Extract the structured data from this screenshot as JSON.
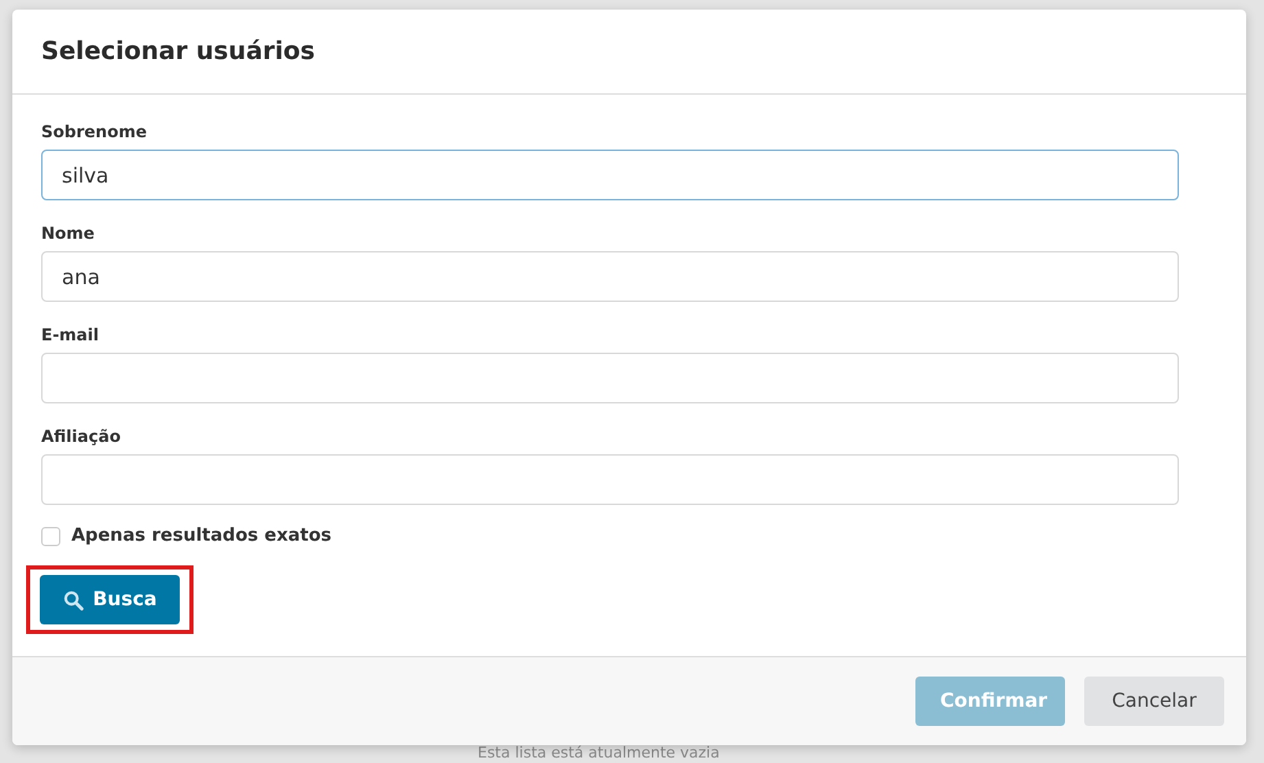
{
  "dialog": {
    "title": "Selecionar usuários",
    "fields": [
      {
        "label": "Sobrenome",
        "value": "silva",
        "focused": true
      },
      {
        "label": "Nome",
        "value": "ana",
        "focused": false
      },
      {
        "label": "E-mail",
        "focused": false
      },
      {
        "label": "Afiliação",
        "focused": false
      }
    ],
    "exact_match": {
      "label": "Apenas resultados exatos",
      "checked": false
    },
    "search_button": {
      "label": "Busca",
      "highlighted": true
    },
    "footer_buttons": [
      {
        "label": "Confirmar",
        "kind": "primary",
        "disabled": true
      },
      {
        "label": "Cancelar",
        "kind": "secondary",
        "disabled": false
      }
    ]
  },
  "background": {
    "empty_list_text": "Esta lista está atualmente vazia"
  }
}
